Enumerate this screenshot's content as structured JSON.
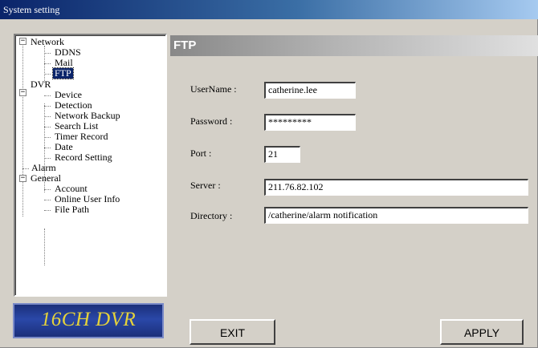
{
  "window": {
    "title": "System setting"
  },
  "tree": {
    "network": {
      "label": "Network",
      "expander": "−",
      "children": [
        "DDNS",
        "Mail",
        "FTP"
      ]
    },
    "dvr": {
      "label": "DVR",
      "expander": "−",
      "children": [
        "Device",
        "Detection",
        "Network Backup",
        "Search List",
        "Timer Record",
        "Date",
        "Record Setting"
      ]
    },
    "alarm": {
      "label": "Alarm"
    },
    "general": {
      "label": "General",
      "expander": "−",
      "children": [
        "Account",
        "Online User Info",
        "File Path"
      ]
    },
    "selected": "FTP"
  },
  "logo": {
    "text": "16CH DVR"
  },
  "panel": {
    "title": "FTP"
  },
  "form": {
    "username": {
      "label": "UserName :",
      "value": "catherine.lee"
    },
    "password": {
      "label": "Password :",
      "value": "*********"
    },
    "port": {
      "label": "Port :",
      "value": "21"
    },
    "server": {
      "label": "Server  :",
      "value": "211.76.82.102"
    },
    "directory": {
      "label": "Directory :",
      "value": "/catherine/alarm notification"
    }
  },
  "buttons": {
    "exit": "EXIT",
    "apply": "APPLY"
  }
}
